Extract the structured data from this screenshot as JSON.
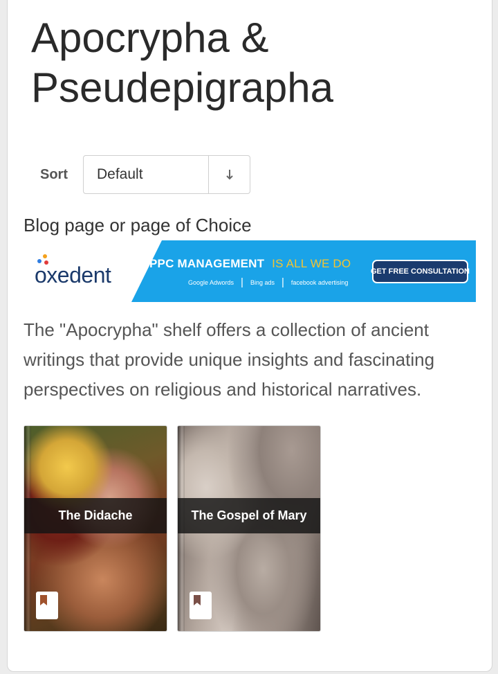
{
  "page": {
    "title_line1": "Apocrypha &",
    "title_line2": "Pseudepigrapha"
  },
  "sort": {
    "label": "Sort",
    "selected": "Default",
    "direction_icon": "arrow-down"
  },
  "blog_label": "Blog page or page of Choice",
  "ad": {
    "brand": "oxedent",
    "headline": "PPC MANAGEMENT",
    "headline_accent": "IS ALL WE DO",
    "partners": [
      "Google Adwords",
      "Bing ads",
      "facebook advertising"
    ],
    "cta": "GET FREE CONSULTATION",
    "colors": {
      "background": "#1aa3e8",
      "accent": "#f4c430",
      "button": "#1a3b6e"
    }
  },
  "intro_text": "The \"Apocrypha\" shelf offers a collection of ancient writings that provide unique insights and fascinating perspectives on religious and historical narratives.",
  "books": [
    {
      "title": "The Didache",
      "icon": "bookmark-icon"
    },
    {
      "title": "The Gospel of Mary",
      "icon": "bookmark-icon"
    }
  ]
}
